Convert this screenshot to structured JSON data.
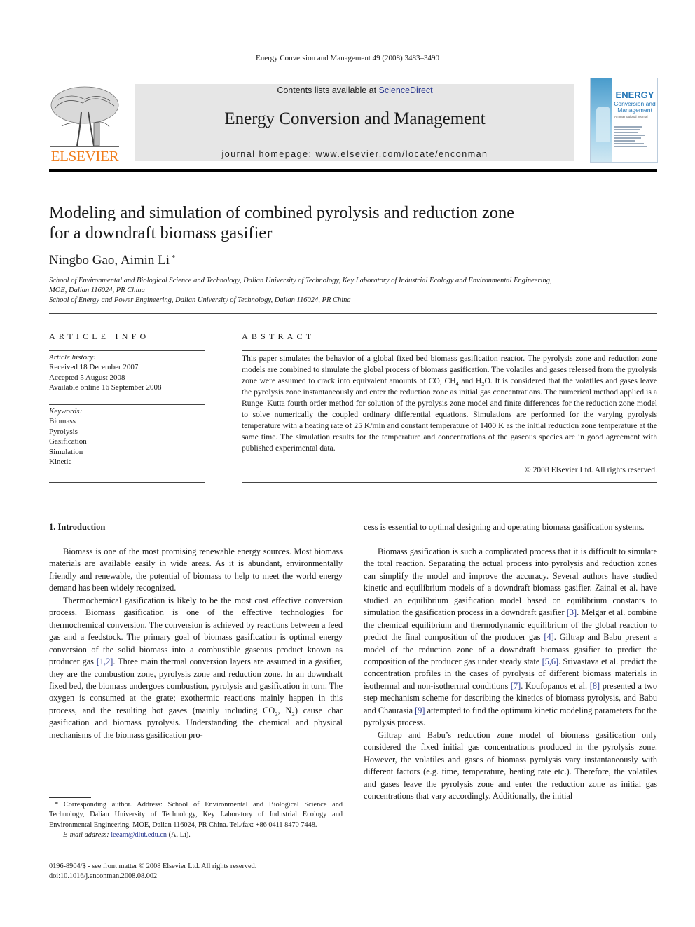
{
  "running_head": "Energy Conversion and Management 49 (2008) 3483–3490",
  "publisher": {
    "logo_icon": "elsevier-tree-icon",
    "wordmark": "ELSEVIER",
    "brand_color": "#f07c1a"
  },
  "masthead": {
    "contents_prefix": "Contents lists available at ",
    "contents_link": "ScienceDirect",
    "journal_title": "Energy Conversion and Management",
    "homepage_label": "journal homepage: ",
    "homepage_url_text": "www.elsevier.com/locate/enconman",
    "background_color": "#e6e6e6"
  },
  "cover": {
    "title": "ENERGY",
    "subtitle_1": "Conversion and",
    "subtitle_2": "Management",
    "tagline": "An International Journal",
    "accent_color": "#1f73b5"
  },
  "article": {
    "title_line_1": "Modeling and simulation of combined pyrolysis and reduction zone",
    "title_line_2": "for a downdraft biomass gasifier",
    "authors": "Ningbo Gao, Aimin Li",
    "corresponding_mark": "*",
    "affiliations": [
      "School of Environmental and Biological Science and Technology, Dalian University of Technology, Key Laboratory of Industrial Ecology and Environmental Engineering,",
      "MOE, Dalian 116024, PR China",
      "School of Energy and Power Engineering, Dalian University of Technology, Dalian 116024, PR China"
    ]
  },
  "article_info": {
    "label": "ARTICLE INFO",
    "history_heading": "Article history:",
    "history": [
      "Received 18 December 2007",
      "Accepted 5 August 2008",
      "Available online 16 September 2008"
    ],
    "keywords_heading": "Keywords:",
    "keywords": [
      "Biomass",
      "Pyrolysis",
      "Gasification",
      "Simulation",
      "Kinetic"
    ]
  },
  "abstract": {
    "label": "ABSTRACT",
    "part_1": "This paper simulates the behavior of a global fixed bed biomass gasification reactor. The pyrolysis zone and reduction zone models are combined to simulate the global process of biomass gasification. The volatiles and gases released from the pyrolysis zone were assumed to crack into equivalent amounts of CO, CH",
    "sub_1": "4",
    "part_2": " and H",
    "sub_2": "2",
    "part_3": "O. It is considered that the volatiles and gases leave the pyrolysis zone instantaneously and enter the reduction zone as initial gas concentrations. The numerical method applied is a Runge–Kutta fourth order method for solution of the pyrolysis zone model and finite differences for the reduction zone model to solve numerically the coupled ordinary differential equations. Simulations are performed for the varying pyrolysis temperature with a heating rate of 25 K/min and constant temperature of 1400 K as the initial reduction zone temperature at the same time. The simulation results for the temperature and concentrations of the gaseous species are in good agreement with published experimental data.",
    "copyright": "© 2008 Elsevier Ltd. All rights reserved."
  },
  "introduction": {
    "heading": "1. Introduction",
    "p1": "Biomass is one of the most promising renewable energy sources. Most biomass materials are available easily in wide areas. As it is abundant, environmentally friendly and renewable, the potential of biomass to help to meet the world energy demand has been widely recognized.",
    "p2_a": "Thermochemical gasification is likely to be the most cost effective conversion process. Biomass gasification is one of the effective technologies for thermochemical conversion. The conversion is achieved by reactions between a feed gas and a feedstock. The primary goal of biomass gasification is optimal energy conversion of the solid biomass into a combustible gaseous product known as producer gas ",
    "p2_ref": "[1,2]",
    "p2_b": ". Three main thermal conversion layers are assumed in a gasifier, they are the combustion zone, pyrolysis zone and reduction zone. In an downdraft fixed bed, the biomass undergoes combustion, pyrolysis and gasification in turn. The oxygen is consumed at the grate; exothermic reactions mainly happen in this process, and the resulting hot gases (mainly including CO",
    "p2_sub1": "2",
    "p2_c": ", N",
    "p2_sub2": "2",
    "p2_d": ") cause char gasification and biomass pyrolysis. Understanding the chemical and physical mechanisms of the biomass gasification process is essential to optimal designing and operating biomass gasification systems.",
    "p3_a": "Biomass gasification is such a complicated process that it is difficult to simulate the total reaction. Separating the actual process into pyrolysis and reduction zones can simplify the model and improve the accuracy. Several authors have studied kinetic and equilibrium models of a downdraft biomass gasifier. Zainal et al. have studied an equilibrium gasification model based on equilibrium constants to simulation the gasification process in a downdraft gasifier ",
    "p3_ref1": "[3]",
    "p3_b": ". Melgar et al. combine the chemical equilibrium and thermodynamic equilibrium of the global reaction to predict the final composition of the producer gas ",
    "p3_ref2": "[4]",
    "p3_c": ". Giltrap and Babu present a model of the reduction zone of a downdraft biomass gasifier to predict the composition of the producer gas under steady state ",
    "p3_ref3": "[5,6]",
    "p3_d": ". Srivastava et al. predict the concentration profiles in the cases of pyrolysis of different biomass materials in isothermal and non-isothermal conditions ",
    "p3_ref4": "[7]",
    "p3_e": ". Koufopanos et al. ",
    "p3_ref5": "[8]",
    "p3_f": " presented a two step mechanism scheme for describing the kinetics of biomass pyrolysis, and Babu and Chaurasia ",
    "p3_ref6": "[9]",
    "p3_g": " attempted to find the optimum kinetic modeling parameters for the pyrolysis process.",
    "p4": "Giltrap and Babu’s reduction zone model of biomass gasification only considered the fixed initial gas concentrations produced in the pyrolysis zone. However, the volatiles and gases of biomass pyrolysis vary instantaneously with different factors (e.g. time, temperature, heating rate etc.). Therefore, the volatiles and gases leave the pyrolysis zone and enter the reduction zone as initial gas concentrations that vary accordingly. Additionally, the initial"
  },
  "footnote": {
    "mark": "*",
    "text": " Corresponding author. Address: School of Environmental and Biological Science and Technology, Dalian University of Technology, Key Laboratory of Industrial Ecology and Environmental Engineering, MOE, Dalian 116024, PR China. Tel./fax: +86 0411 8470 7448.",
    "email_label": "E-mail address: ",
    "email": "leeam@dlut.edu.cn",
    "email_suffix": " (A. Li)."
  },
  "front_matter": {
    "issn_line": "0196-8904/$ - see front matter © 2008 Elsevier Ltd. All rights reserved.",
    "doi": "doi:10.1016/j.enconman.2008.08.002"
  }
}
